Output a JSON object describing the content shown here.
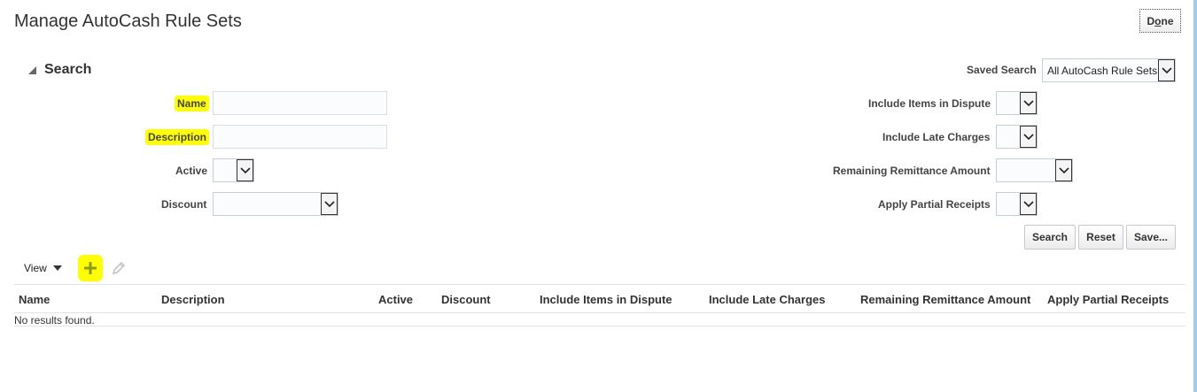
{
  "page": {
    "title": "Manage AutoCash Rule Sets",
    "done_prefix": "D",
    "done_underline": "o",
    "done_suffix": "ne"
  },
  "search": {
    "title": "Search",
    "saved_search_label": "Saved Search",
    "saved_search_value": "All AutoCash Rule Sets",
    "fields": {
      "name_label": "Name",
      "name_value": "",
      "description_label": "Description",
      "description_value": "",
      "active_label": "Active",
      "active_value": "",
      "discount_label": "Discount",
      "discount_value": "",
      "dispute_label": "Include Items in Dispute",
      "dispute_value": "",
      "late_label": "Include Late Charges",
      "late_value": "",
      "remit_label": "Remaining Remittance Amount",
      "remit_value": "",
      "partial_label": "Apply Partial Receipts",
      "partial_value": ""
    },
    "buttons": {
      "search": "Search",
      "reset": "Reset",
      "save": "Save..."
    }
  },
  "toolbar": {
    "view_label": "View",
    "add_icon": "plus-icon",
    "edit_icon": "pencil-icon"
  },
  "table": {
    "columns": [
      "Name",
      "Description",
      "Active",
      "Discount",
      "Include Items in Dispute",
      "Include Late Charges",
      "Remaining Remittance Amount",
      "Apply Partial Receipts"
    ],
    "empty_message": "No results found."
  },
  "colors": {
    "highlight": "#ffff00",
    "add_icon": "#8a9a1b",
    "window_edge": "#9ecbf0"
  }
}
